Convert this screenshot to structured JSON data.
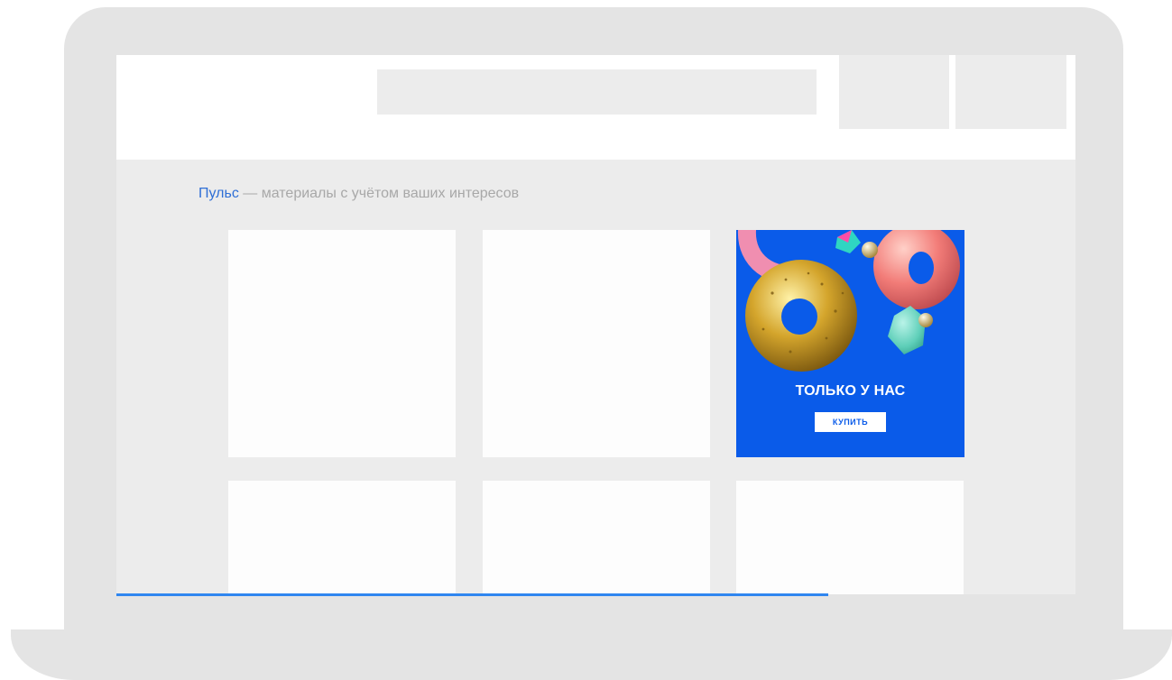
{
  "pulse": {
    "link_text": "Пульс",
    "description": " — материалы с учётом ваших интересов"
  },
  "ad": {
    "title": "ТОЛЬКО У НАС",
    "button_label": "КУПИТЬ",
    "background_color": "#0a5be9"
  },
  "colors": {
    "accent": "#2f6fd6",
    "progress": "#2f86f0"
  }
}
